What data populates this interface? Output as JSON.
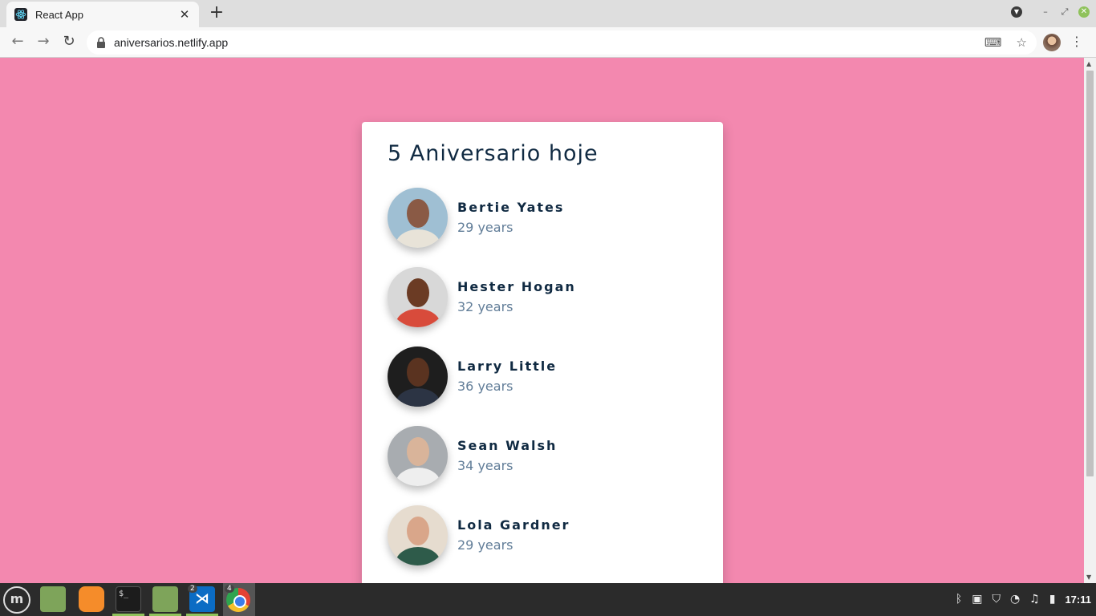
{
  "browser": {
    "tab_title": "React App",
    "tab_close": "✕",
    "new_tab": "+",
    "url": "aniversarios.netlify.app"
  },
  "page": {
    "title": "5 Aniversario hoje",
    "people": [
      {
        "name": "Bertie Yates",
        "age": "29 years",
        "bg": "#9fbfd3",
        "skin": "#8a5a45",
        "cloth": "#e8e3d8"
      },
      {
        "name": "Hester Hogan",
        "age": "32 years",
        "bg": "#d8d8d8",
        "skin": "#6b3b24",
        "cloth": "#d84b3b"
      },
      {
        "name": "Larry Little",
        "age": "36 years",
        "bg": "#1e1e1e",
        "skin": "#5a3320",
        "cloth": "#2c3444"
      },
      {
        "name": "Sean Walsh",
        "age": "34 years",
        "bg": "#a8acb0",
        "skin": "#d9b49a",
        "cloth": "#eeeeee"
      },
      {
        "name": "Lola Gardner",
        "age": "29 years",
        "bg": "#e6dccf",
        "skin": "#d9a68a",
        "cloth": "#2e5b4a"
      }
    ]
  },
  "taskbar": {
    "vscode_badge": "2",
    "chrome_badge": "4",
    "clock": "17:11"
  },
  "colors": {
    "background": "#f388af",
    "title": "#102a42",
    "age": "#617d98"
  }
}
